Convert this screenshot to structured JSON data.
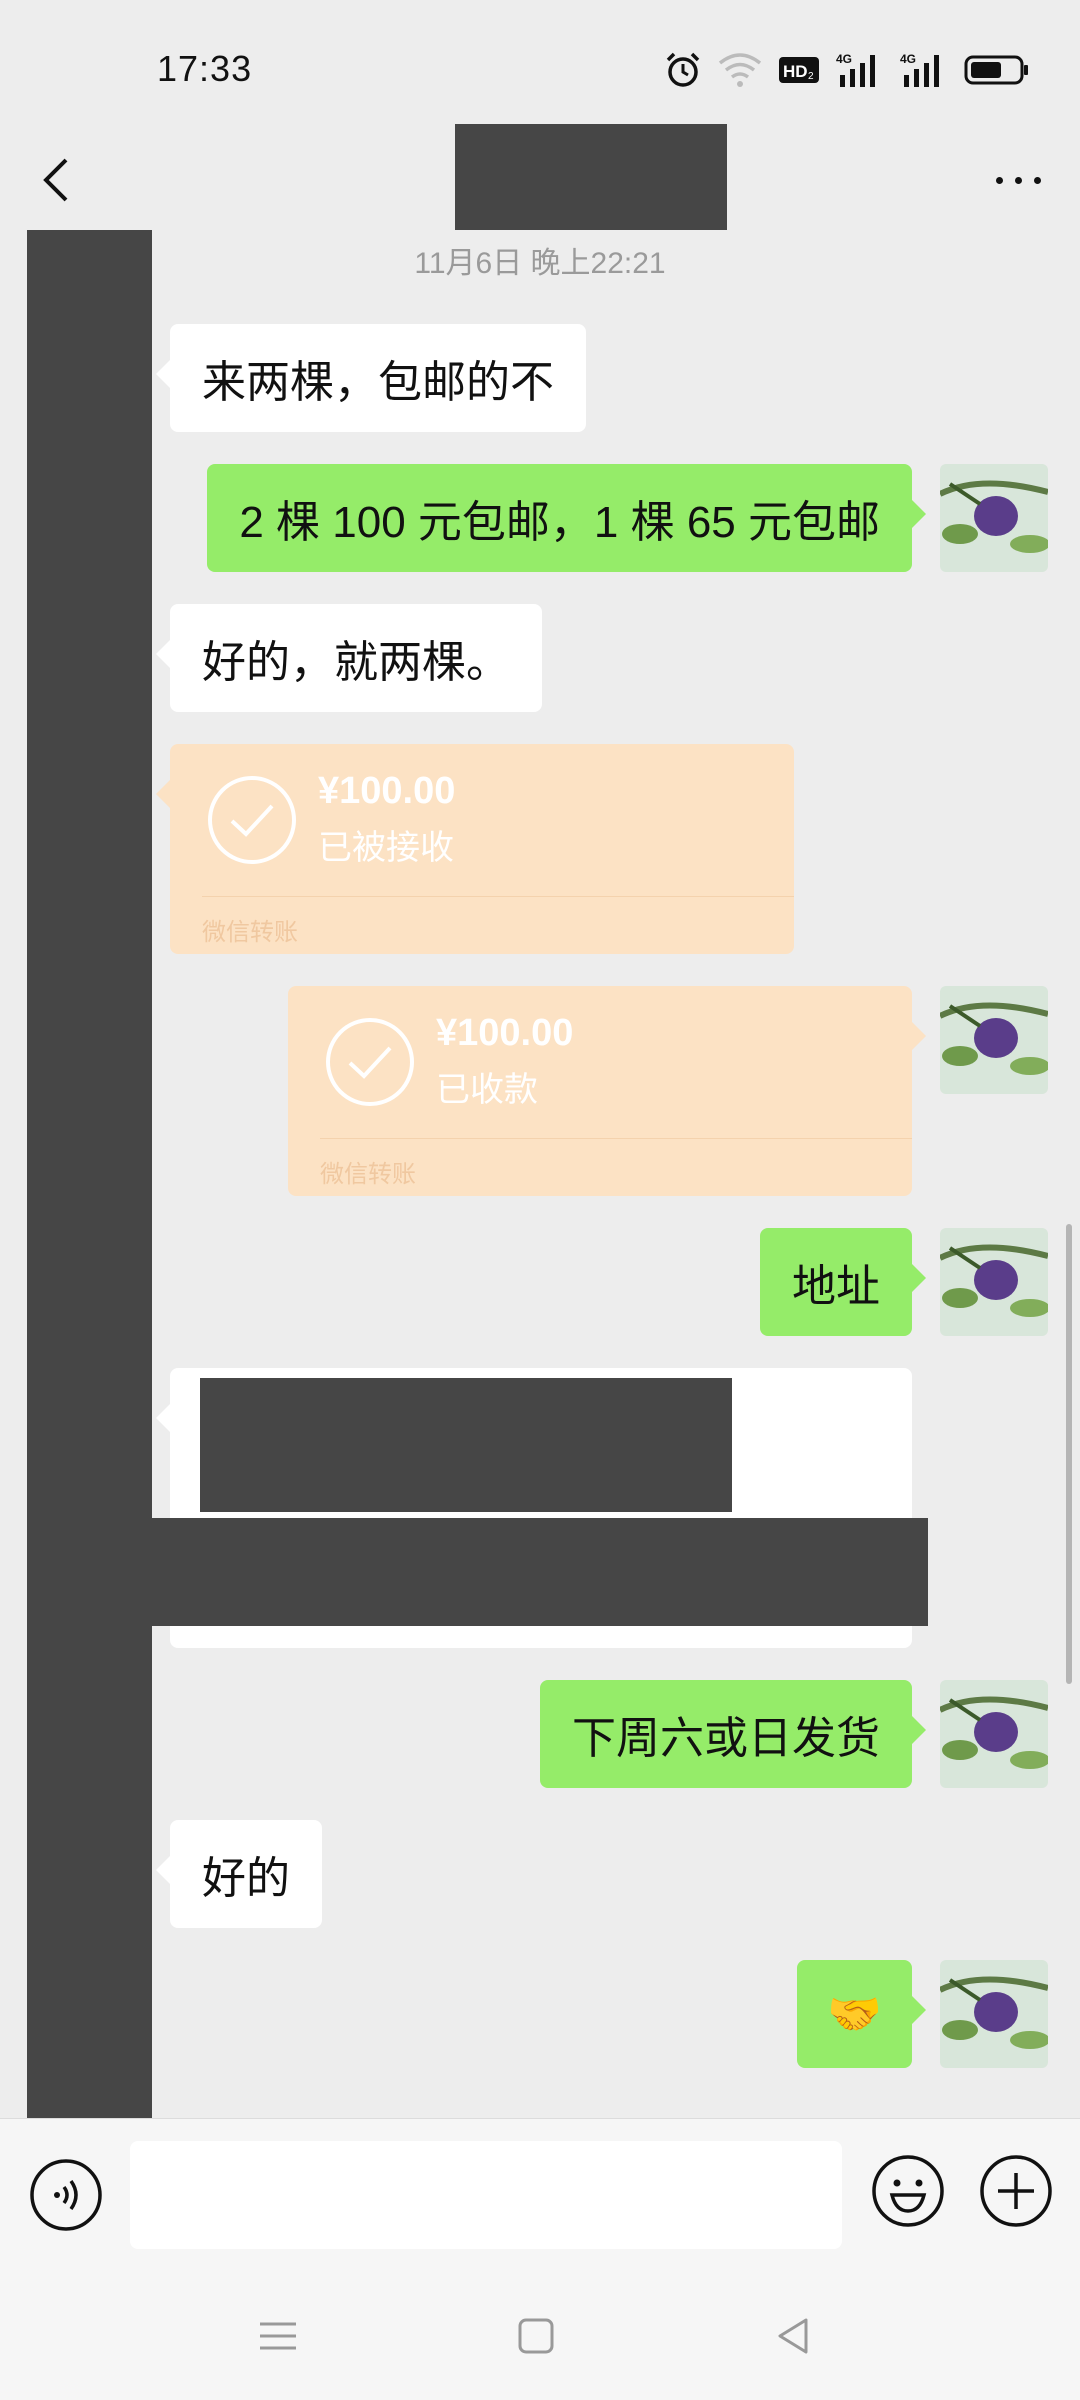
{
  "status_bar": {
    "time": "17:33",
    "icons": [
      "alarm-icon",
      "wifi-icon",
      "hd-icon",
      "4g-signal-icon",
      "4g-signal-icon",
      "battery-icon"
    ],
    "hd_label": "HD",
    "network_label": "4G"
  },
  "header": {
    "back_icon": "chevron-left-icon",
    "title": "",
    "more_icon": "more-dots-icon"
  },
  "chat": {
    "timestamp": "11月6日 晚上22:21",
    "messages": [
      {
        "side": "left",
        "text": "来两棵，包邮的不"
      },
      {
        "side": "right",
        "text": "2 棵 100 元包邮，1 棵 65 元包邮"
      },
      {
        "side": "left",
        "text": "好的，就两棵。"
      },
      {
        "side": "left",
        "type": "transfer",
        "amount": "¥100.00",
        "status": "已被接收",
        "footer": "微信转账"
      },
      {
        "side": "right",
        "type": "transfer",
        "amount": "¥100.00",
        "status": "已收款",
        "footer": "微信转账"
      },
      {
        "side": "right",
        "text": "地址"
      },
      {
        "side": "left",
        "type": "redacted"
      },
      {
        "side": "right",
        "text": "下周六或日发货"
      },
      {
        "side": "left",
        "text": "好的"
      },
      {
        "side": "right",
        "text": "🤝"
      }
    ]
  },
  "input_bar": {
    "placeholder": "",
    "icons": [
      "voice-icon",
      "emoji-icon",
      "plus-icon"
    ]
  },
  "system_nav": {
    "icons": [
      "menu-icon",
      "home-icon",
      "back-triangle-icon"
    ]
  },
  "colors": {
    "background": "#ededed",
    "bubble_self": "#95ec69",
    "bubble_other": "#ffffff",
    "transfer": "#fce2c4",
    "redaction": "#464646"
  }
}
